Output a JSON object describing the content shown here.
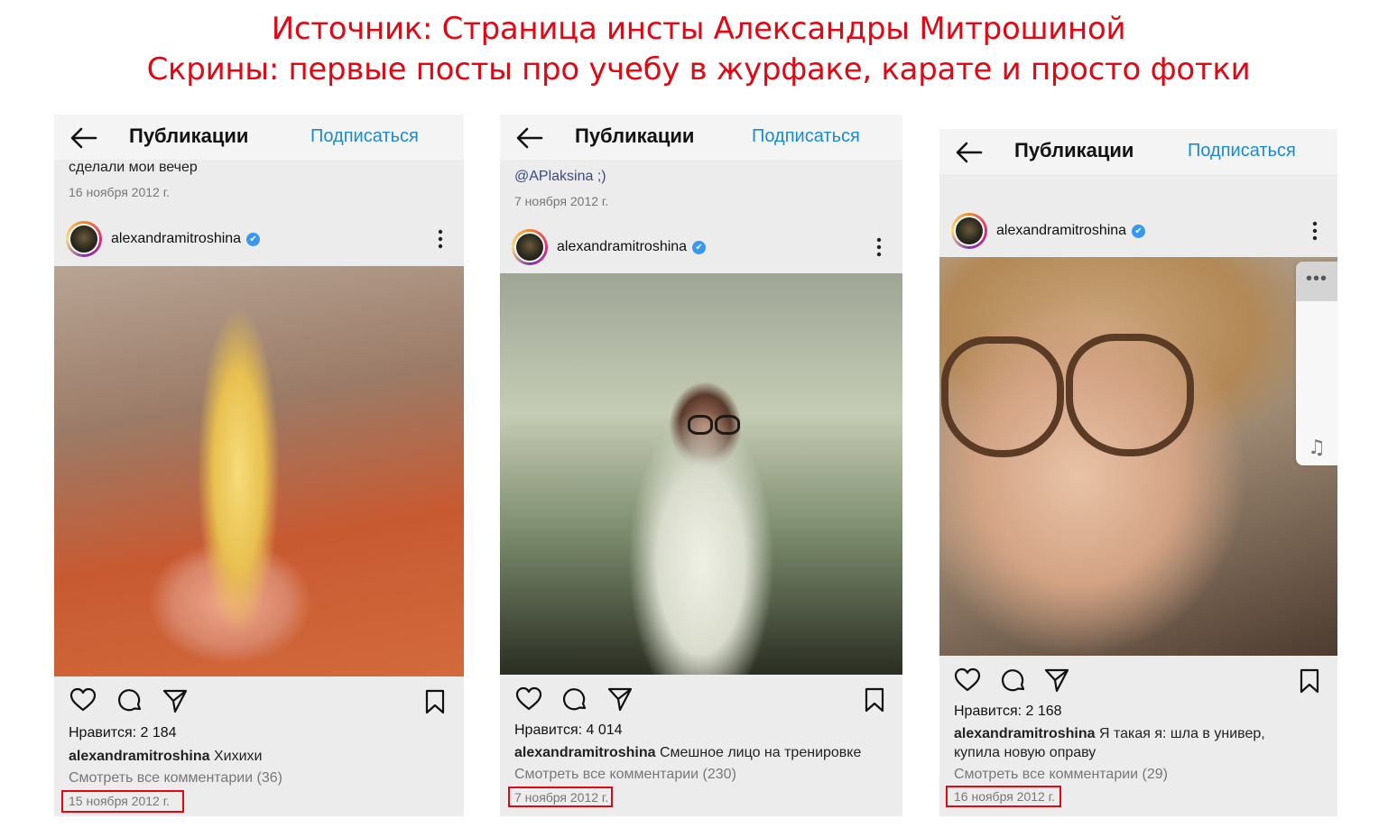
{
  "header": {
    "line1": "Источник: Страница инсты Александры Митрошиной",
    "line2": "Скрины: первые посты про учебу в журфаке, карате и просто фотки"
  },
  "colors": {
    "accent_red": "#e30613",
    "link_blue": "#1a8ad6",
    "verified_blue": "#3897f0"
  },
  "posts": [
    {
      "topbar_title": "Публикации",
      "subscribe_label": "Подписаться",
      "prev_caption": "сделали мои вечер",
      "prev_date": "16 ноября 2012 г.",
      "username": "alexandramitroshina",
      "verified_icon": "✔",
      "likes": "Нравится: 2 184",
      "caption_user": "alexandramitroshina",
      "caption_text": "Хихихи",
      "comments": "Смотреть все комментарии (36)",
      "date": "15 ноября 2012 г."
    },
    {
      "topbar_title": "Публикации",
      "subscribe_label": "Подписаться",
      "prev_caption": "@APlaksina ;)",
      "prev_date": "7 ноября 2012 г.",
      "username": "alexandramitroshina",
      "verified_icon": "✔",
      "likes": "Нравится: 4 014",
      "caption_user": "alexandramitroshina",
      "caption_text": "Смешное лицо на тренировке",
      "comments": "Смотреть все комментарии (230)",
      "date": "7 ноября 2012 г."
    },
    {
      "topbar_title": "Публикации",
      "subscribe_label": "Подписаться",
      "username": "alexandramitroshina",
      "verified_icon": "✔",
      "likes": "Нравится: 2 168",
      "caption_user": "alexandramitroshina",
      "caption_text": "Я такая я: шла в универ, купила новую оправу",
      "comments": "Смотреть все комментарии (29)",
      "date": "16 ноября 2012 г."
    }
  ],
  "side_panel": {
    "more_icon": "•••",
    "music_icon": "♫"
  }
}
